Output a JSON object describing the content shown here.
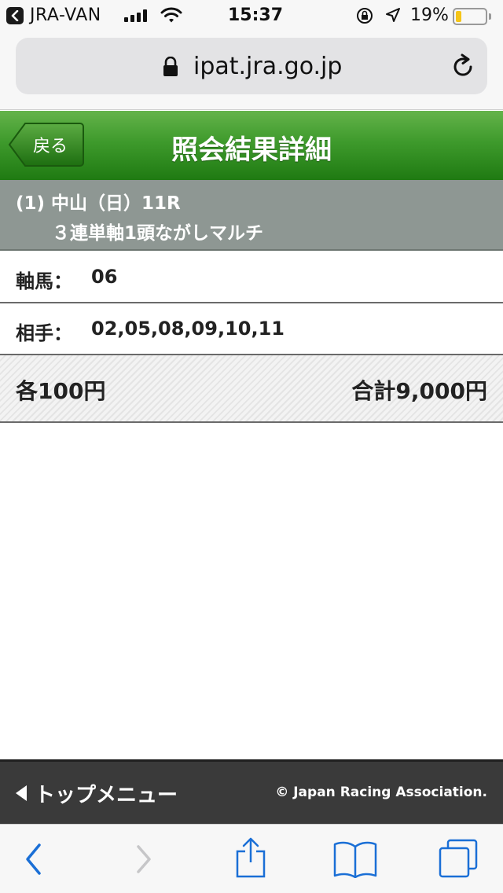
{
  "status_bar": {
    "carrier": "JRA-VAN",
    "time": "15:37",
    "battery_percent": "19%",
    "battery_level": 0.19,
    "icons": [
      "back-to-app-icon",
      "signal-icon",
      "wifi-icon",
      "orientation-lock-icon",
      "location-icon",
      "battery-icon"
    ]
  },
  "browser": {
    "url": "ipat.jra.go.jp",
    "icons": [
      "lock-icon",
      "reload-icon"
    ]
  },
  "header": {
    "back_label": "戻る",
    "title": "照会結果詳細",
    "accent_color": "#2f8a1e"
  },
  "race": {
    "line1": "(1) 中山（日）11R",
    "line2": "３連単軸1頭ながしマルチ"
  },
  "bet": {
    "axis_label": "軸馬：",
    "axis_value": "06",
    "partner_label": "相手：",
    "partner_value": "02,05,08,09,10,11",
    "each": "各100円",
    "total": "合計9,000円"
  },
  "footer": {
    "top_menu": "トップメニュー",
    "copyright": "© Japan Racing Association."
  },
  "toolbar": {
    "icons": [
      "back-icon",
      "forward-icon",
      "share-icon",
      "bookmarks-icon",
      "tabs-icon"
    ],
    "tint_color": "#1a6fd6"
  }
}
